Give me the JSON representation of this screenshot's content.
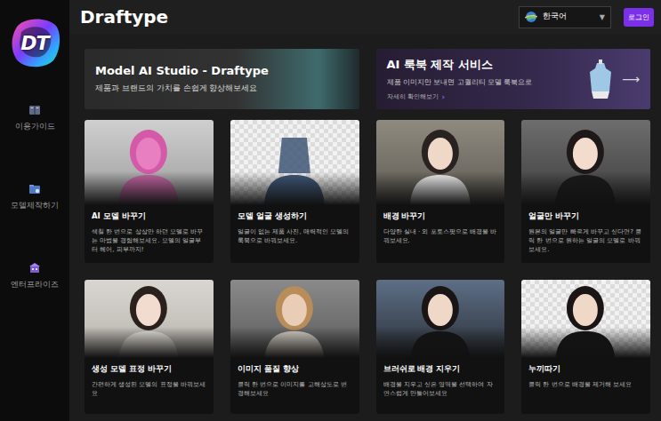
{
  "sidebar": {
    "logo": "DT",
    "items": [
      {
        "label": "이용가이드"
      },
      {
        "label": "모델제작하기"
      },
      {
        "label": "엔터프라이즈"
      }
    ]
  },
  "header": {
    "title": "Draftype",
    "language": {
      "value": "한국어",
      "caret": "▼"
    },
    "login": "로그인"
  },
  "banners": [
    {
      "title": "Model AI Studio - Draftype",
      "subtitle": "제품과 브랜드의 가치를 손쉽게 향상해보세요"
    },
    {
      "title": "AI 룩북 제작 서비스",
      "subtitle": "제품 이미지만 보내면 고퀄리티 모델 룩북으로",
      "link": "자세히 확인해보기",
      "link_icon": "›",
      "arrow": "⟶"
    }
  ],
  "cards": [
    {
      "title": "AI 모델 바꾸기",
      "description": "색칠 한 번으로 상상만 하던 모델로 바꾸는 마법을 경험해보세요. 모델의 얼굴부터 헤어, 피부까지!"
    },
    {
      "title": "모델 얼굴 생성하기",
      "description": "얼굴이 없는 제품 사진, 매력적인 모델의 룩북으로 바꿔보세요."
    },
    {
      "title": "배경 바꾸기",
      "description": "다양한 실내 · 외 포토스팟으로 배경을 바꿔보세요."
    },
    {
      "title": "얼굴만 바꾸기",
      "description": "원본의 얼굴만 빠르게 바꾸고 싶다면? 클릭 한 번으로 원하는 얼굴의 모델로 바꿔보세요."
    },
    {
      "title": "생성 모델 표정 바꾸기",
      "description": "간편하게 생성된 모델의 표정을 바꿔보세요"
    },
    {
      "title": "이미지 품질 향상",
      "description": "클릭 한 번으로 이미지를 고해상도로 변경해보세요"
    },
    {
      "title": "브러쉬로 배경 지우기",
      "description": "배경을 지우고 싶은 영역을 선택하여 자연스럽게 만들어보세요"
    },
    {
      "title": "누끼따기",
      "description": "클릭 한 번으로 배경을 제거해 보세요"
    }
  ]
}
